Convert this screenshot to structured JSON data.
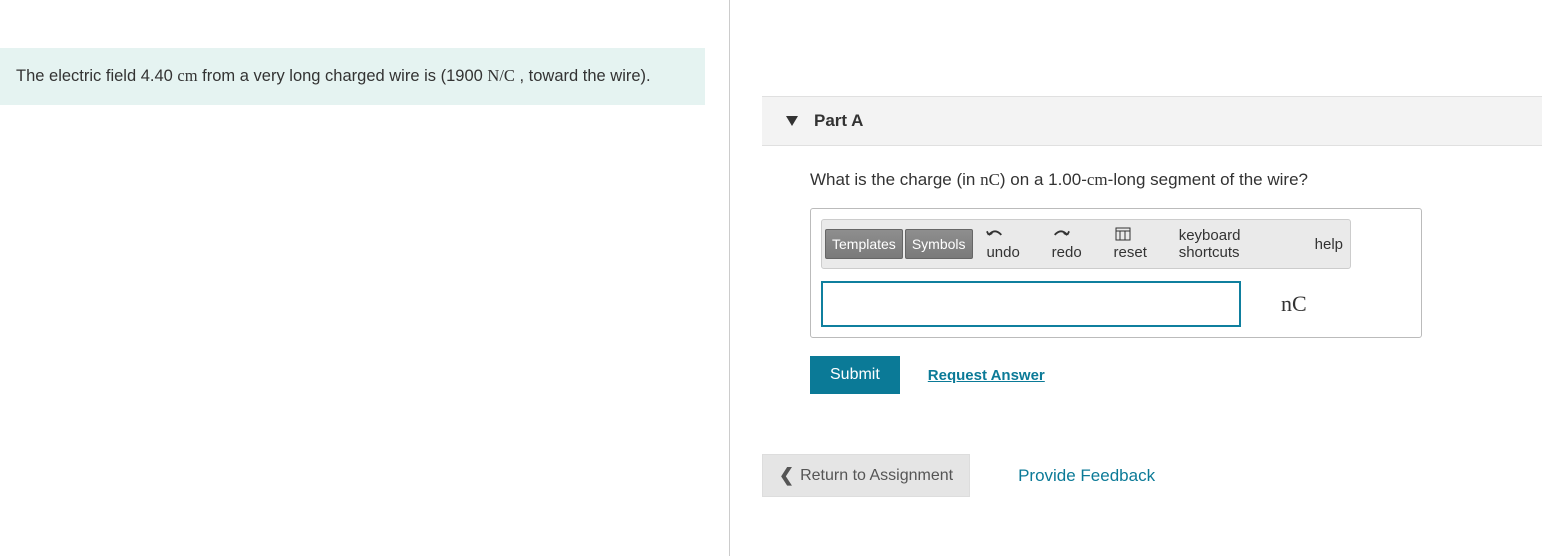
{
  "problem": {
    "prefix": "The electric field 4.40 ",
    "unit_cm": "cm",
    "mid": " from a very long charged wire is (1900 ",
    "unit_nc_ratio": "N/C",
    "suffix": " , toward the wire)."
  },
  "part": {
    "label": "Part A",
    "question_prefix": "What is the charge (in ",
    "question_unit": "nC",
    "question_mid": ") on a 1.00-",
    "question_cm": "cm",
    "question_suffix": "-long segment of the wire?"
  },
  "toolbar": {
    "templates": "Templates",
    "symbols": "Symbols",
    "undo": "undo",
    "redo": "redo",
    "reset": "reset",
    "keyboard": "keyboard shortcuts",
    "help": "help"
  },
  "answer": {
    "value": "",
    "unit": "nC"
  },
  "buttons": {
    "submit": "Submit",
    "request_answer": "Request Answer",
    "return": "Return to Assignment",
    "feedback": "Provide Feedback"
  }
}
